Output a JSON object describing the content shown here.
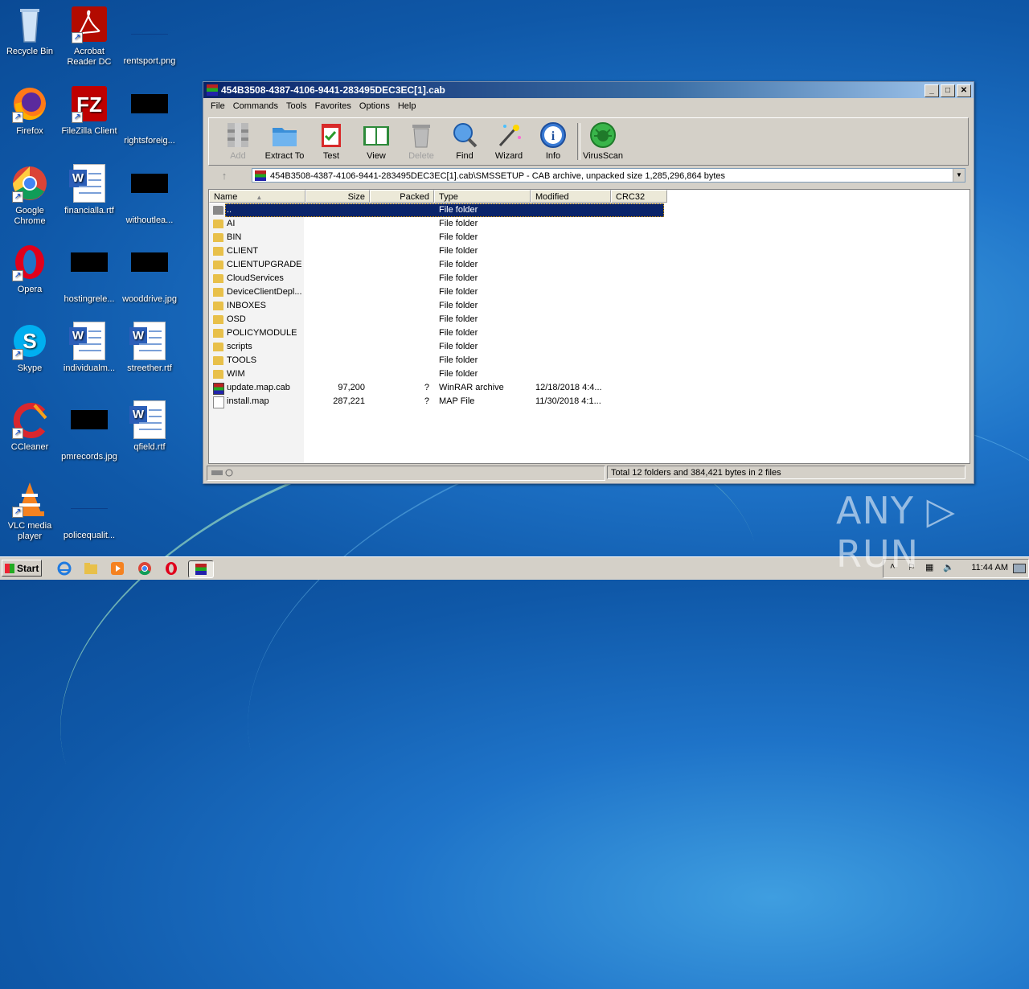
{
  "desktop": {
    "icons": [
      {
        "label": "Recycle Bin"
      },
      {
        "label": "Acrobat Reader DC"
      },
      {
        "label": "rentsport.png"
      },
      {
        "label": "Firefox"
      },
      {
        "label": "FileZilla Client"
      },
      {
        "label": "rightsforeig..."
      },
      {
        "label": "Google Chrome"
      },
      {
        "label": "financialla.rtf"
      },
      {
        "label": "withoutlea..."
      },
      {
        "label": "Opera"
      },
      {
        "label": "hostingrele..."
      },
      {
        "label": "wooddrive.jpg"
      },
      {
        "label": "Skype"
      },
      {
        "label": "individualm..."
      },
      {
        "label": "streether.rtf"
      },
      {
        "label": "CCleaner"
      },
      {
        "label": "pmrecords.jpg"
      },
      {
        "label": "qfield.rtf"
      },
      {
        "label": "VLC media player"
      },
      {
        "label": "policequalit..."
      }
    ]
  },
  "window": {
    "title": "454B3508-4387-4106-9441-283495DEC3EC[1].cab",
    "controls": {
      "minimize": "_",
      "maximize": "□",
      "close": "✕"
    },
    "menu": [
      "File",
      "Commands",
      "Tools",
      "Favorites",
      "Options",
      "Help"
    ],
    "toolbar": [
      {
        "label": "Add",
        "icon": "add-icon"
      },
      {
        "label": "Extract To",
        "icon": "extract-icon"
      },
      {
        "label": "Test",
        "icon": "test-icon"
      },
      {
        "label": "View",
        "icon": "view-icon"
      },
      {
        "label": "Delete",
        "icon": "delete-icon"
      },
      {
        "label": "Find",
        "icon": "find-icon"
      },
      {
        "label": "Wizard",
        "icon": "wizard-icon"
      },
      {
        "label": "Info",
        "icon": "info-icon"
      },
      {
        "label": "VirusScan",
        "icon": "virusscan-icon"
      }
    ],
    "address": "454B3508-4387-4106-9441-283495DEC3EC[1].cab\\SMSSETUP - CAB archive, unpacked size 1,285,296,864 bytes",
    "up_arrow": "↑",
    "columns": [
      "Name",
      "Size",
      "Packed",
      "Type",
      "Modified",
      "CRC32"
    ],
    "rows": [
      {
        "name": "..",
        "size": "",
        "packed": "",
        "type": "File folder",
        "modified": ""
      },
      {
        "name": "AI",
        "size": "",
        "packed": "",
        "type": "File folder",
        "modified": ""
      },
      {
        "name": "BIN",
        "size": "",
        "packed": "",
        "type": "File folder",
        "modified": ""
      },
      {
        "name": "CLIENT",
        "size": "",
        "packed": "",
        "type": "File folder",
        "modified": ""
      },
      {
        "name": "CLIENTUPGRADE",
        "size": "",
        "packed": "",
        "type": "File folder",
        "modified": ""
      },
      {
        "name": "CloudServices",
        "size": "",
        "packed": "",
        "type": "File folder",
        "modified": ""
      },
      {
        "name": "DeviceClientDepl...",
        "size": "",
        "packed": "",
        "type": "File folder",
        "modified": ""
      },
      {
        "name": "INBOXES",
        "size": "",
        "packed": "",
        "type": "File folder",
        "modified": ""
      },
      {
        "name": "OSD",
        "size": "",
        "packed": "",
        "type": "File folder",
        "modified": ""
      },
      {
        "name": "POLICYMODULE",
        "size": "",
        "packed": "",
        "type": "File folder",
        "modified": ""
      },
      {
        "name": "scripts",
        "size": "",
        "packed": "",
        "type": "File folder",
        "modified": ""
      },
      {
        "name": "TOOLS",
        "size": "",
        "packed": "",
        "type": "File folder",
        "modified": ""
      },
      {
        "name": "WIM",
        "size": "",
        "packed": "",
        "type": "File folder",
        "modified": ""
      },
      {
        "name": "update.map.cab",
        "size": "97,200",
        "packed": "?",
        "type": "WinRAR archive",
        "modified": "12/18/2018 4:4..."
      },
      {
        "name": "install.map",
        "size": "287,221",
        "packed": "?",
        "type": "MAP File",
        "modified": "11/30/2018 4:1..."
      }
    ],
    "status": "Total 12 folders and 384,421 bytes in 2 files"
  },
  "taskbar": {
    "start_label": "Start",
    "clock": "11:44 AM"
  },
  "watermark": "ANY ▷ RUN",
  "colors": {
    "accent": "#0a246a",
    "desktop": "#1e73c8"
  }
}
